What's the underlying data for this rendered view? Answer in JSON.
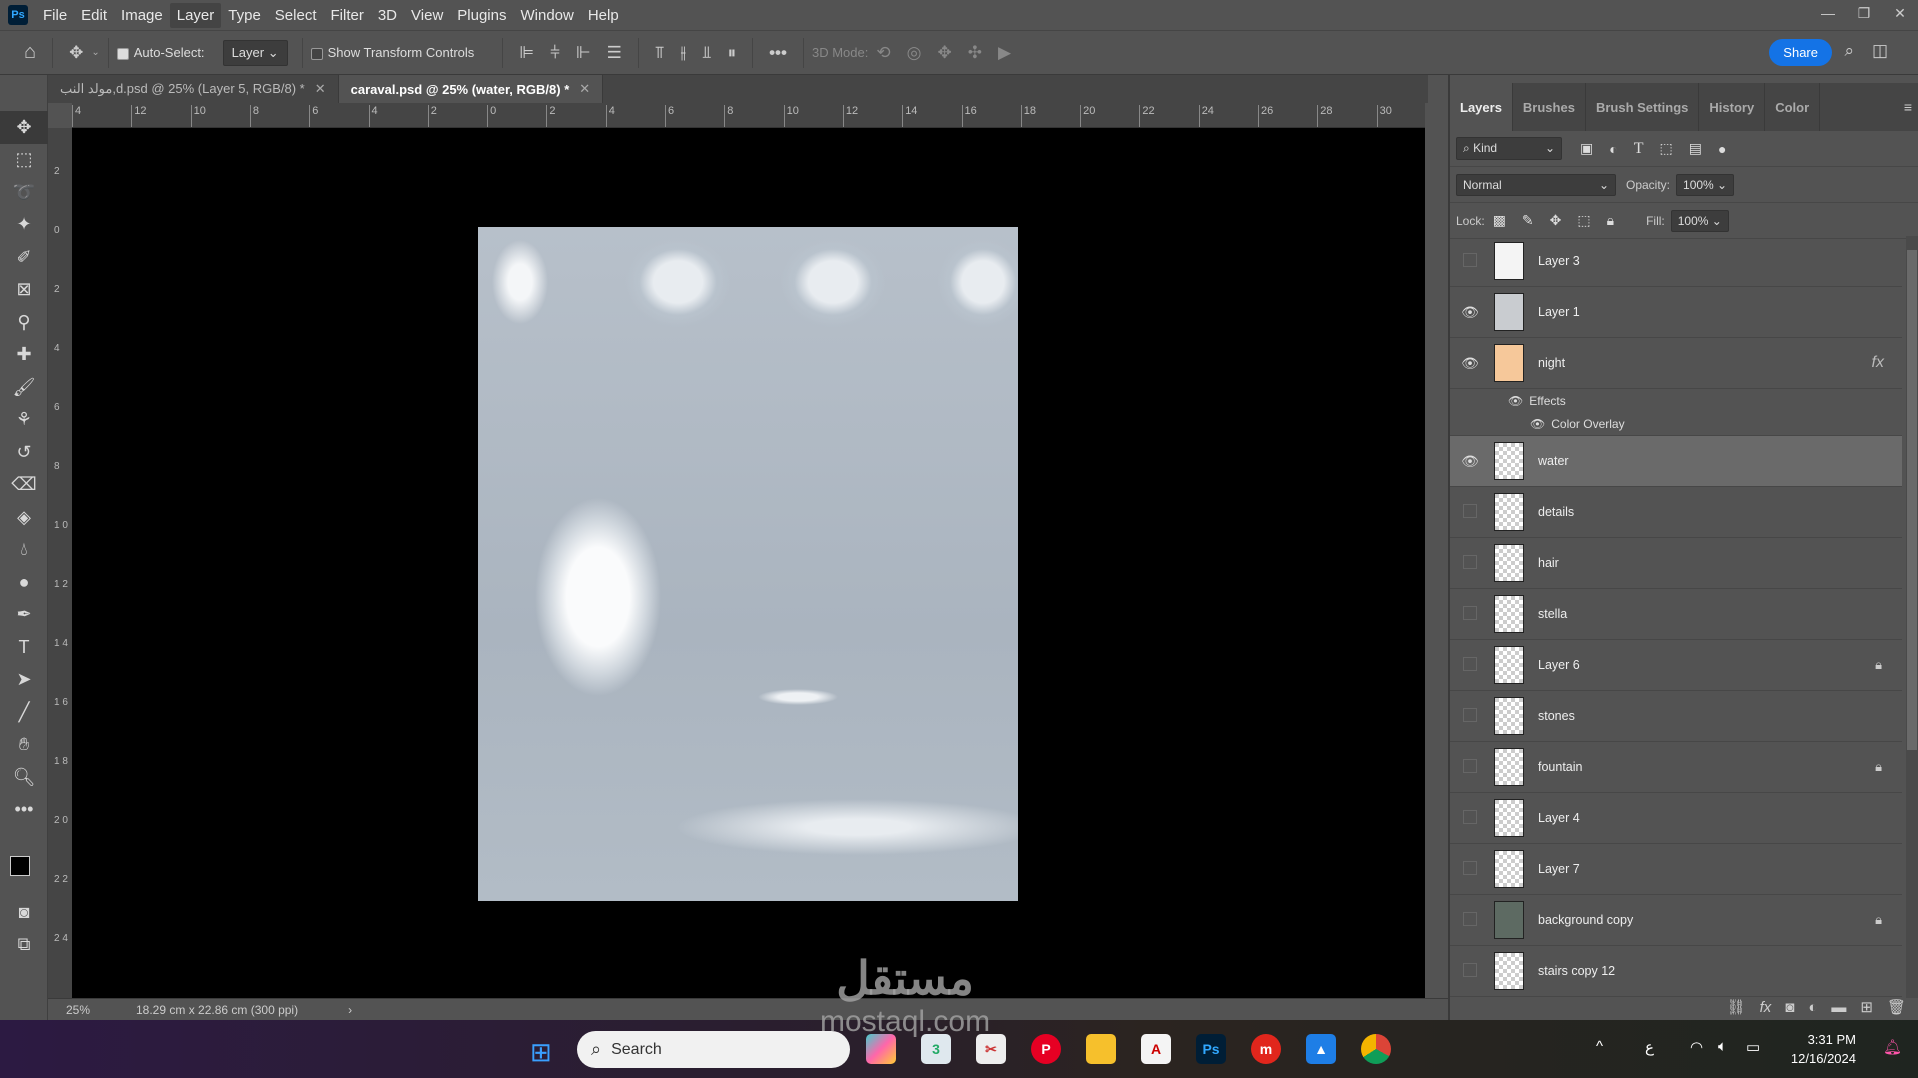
{
  "menu": [
    "File",
    "Edit",
    "Image",
    "Layer",
    "Type",
    "Select",
    "Filter",
    "3D",
    "View",
    "Plugins",
    "Window",
    "Help"
  ],
  "app_logo": "Ps",
  "options": {
    "auto_select_label": "Auto-Select:",
    "auto_select_checked": true,
    "layer_dropdown": "Layer",
    "show_transform_label": "Show Transform Controls",
    "show_transform_checked": false,
    "three_d_mode_label": "3D Mode:",
    "more": "•••",
    "share_label": "Share"
  },
  "tabs": [
    {
      "label": "مولد النب,d.psd @ 25% (Layer 5, RGB/8) *",
      "active": false
    },
    {
      "label": "caraval.psd @ 25% (water, RGB/8) *",
      "active": true
    }
  ],
  "ruler_top": [
    "4",
    "12",
    "10",
    "8",
    "6",
    "4",
    "2",
    "0",
    "2",
    "4",
    "6",
    "8",
    "10",
    "12",
    "14",
    "16",
    "18",
    "20",
    "22",
    "24",
    "26",
    "28",
    "30"
  ],
  "ruler_left": [
    "2",
    "0",
    "2",
    "4",
    "6",
    "8",
    "1 0",
    "1 2",
    "1 4",
    "1 6",
    "1 8",
    "2 0",
    "2 2",
    "2 4"
  ],
  "status": {
    "zoom": "25%",
    "doc_size": "18.29 cm x 22.86 cm (300 ppi)",
    "arrow": "›"
  },
  "watermark": {
    "ar": "مستقل",
    "en": "mostaql.com"
  },
  "panel": {
    "tabs": [
      "Layers",
      "Brushes",
      "Brush Settings",
      "History",
      "Color"
    ],
    "filter_kind": "Kind",
    "blend_mode": "Normal",
    "opacity_label": "Opacity:",
    "opacity": "100%",
    "lock_label": "Lock:",
    "fill_label": "Fill:",
    "fill": "100%",
    "effects_label": "Effects",
    "color_overlay_label": "Color Overlay",
    "fx": "fx",
    "layers": [
      {
        "name": "Layer 3",
        "visible": false,
        "locked": false,
        "thumb": "#f4f4f4"
      },
      {
        "name": "Layer 1",
        "visible": true,
        "locked": false,
        "thumb": "#c9ccd0"
      },
      {
        "name": "night",
        "visible": true,
        "locked": false,
        "thumb": "#f6c89a",
        "fx": true
      },
      {
        "name": "water",
        "visible": true,
        "locked": false,
        "selected": true
      },
      {
        "name": "details",
        "visible": false,
        "locked": false
      },
      {
        "name": "hair",
        "visible": false,
        "locked": false
      },
      {
        "name": "stella",
        "visible": false,
        "locked": false
      },
      {
        "name": "Layer 6",
        "visible": false,
        "locked": true
      },
      {
        "name": "stones",
        "visible": false,
        "locked": false
      },
      {
        "name": "fountain",
        "visible": false,
        "locked": true
      },
      {
        "name": "Layer 4",
        "visible": false,
        "locked": false
      },
      {
        "name": "Layer 7",
        "visible": false,
        "locked": false
      },
      {
        "name": "background copy",
        "visible": false,
        "locked": true,
        "thumb": "#5d6a62"
      },
      {
        "name": "stairs copy 12",
        "visible": false,
        "locked": false
      }
    ]
  },
  "taskbar": {
    "search_placeholder": "Search",
    "time": "3:31 PM",
    "date": "12/16/2024",
    "lang": "ع"
  }
}
